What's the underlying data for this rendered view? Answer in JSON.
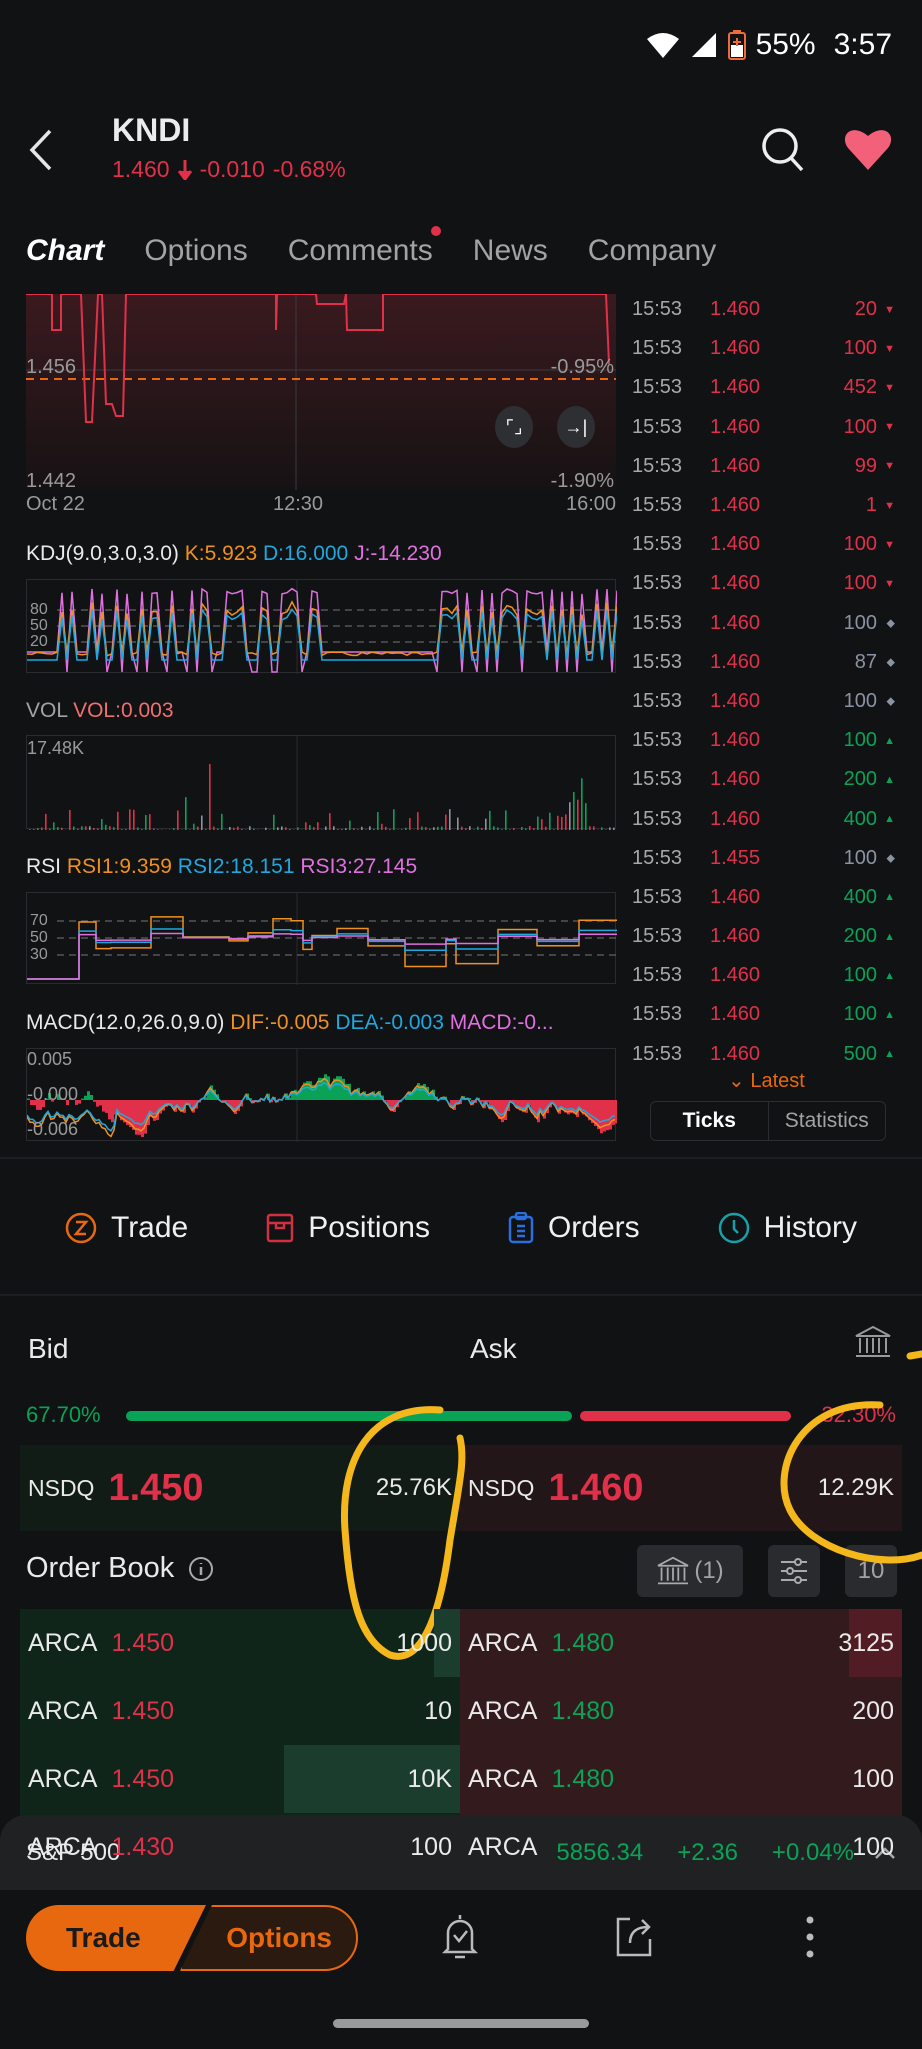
{
  "status_bar": {
    "battery": "55%",
    "time": "3:57"
  },
  "header": {
    "ticker": "KNDI",
    "price": "1.460",
    "change": "-0.010",
    "change_pct": "-0.68%",
    "direction": "down"
  },
  "tabs": [
    {
      "label": "Chart",
      "active": true
    },
    {
      "label": "Options",
      "active": false
    },
    {
      "label": "Comments",
      "active": false,
      "badge": true
    },
    {
      "label": "News",
      "active": false
    },
    {
      "label": "Company",
      "active": false
    }
  ],
  "colors": {
    "up": "#0aa257",
    "down": "#e0304a",
    "accent": "#e8680f",
    "neutral": "#8a93a3",
    "kdj_k": "#f0901e",
    "kdj_d": "#1fa8e0",
    "kdj_j": "#e070e0"
  },
  "price_chart": {
    "left_labels": [
      "1.456",
      "1.442"
    ],
    "right_labels": [
      "-0.95%",
      "-1.90%"
    ],
    "x_labels": [
      "Oct 22",
      "12:30",
      "16:00"
    ],
    "prev_close_line": "dashed-orange",
    "buttons": [
      "fullscreen",
      "jump-to-latest"
    ]
  },
  "indicators": {
    "kdj": {
      "name": "KDJ(9.0,3.0,3.0)",
      "k": "K:5.923",
      "d": "D:16.000",
      "j": "J:-14.230",
      "levels": [
        "80",
        "50",
        "20"
      ]
    },
    "vol": {
      "name": "VOL",
      "value": "VOL:0.003",
      "max_label": "17.48K"
    },
    "rsi": {
      "name": "RSI",
      "rsi1": "RSI1:9.359",
      "rsi2": "RSI2:18.151",
      "rsi3": "RSI3:27.145",
      "levels": [
        "70",
        "50",
        "30"
      ]
    },
    "macd": {
      "name": "MACD(12.0,26.0,9.0)",
      "dif": "DIF:-0.005",
      "dea": "DEA:-0.003",
      "macd": "MACD:-0...",
      "labels": [
        "0.005",
        "-0.000",
        "-0.006"
      ]
    }
  },
  "ticks": [
    {
      "time": "15:53",
      "price": "1.460",
      "volume": "20",
      "side": "down"
    },
    {
      "time": "15:53",
      "price": "1.460",
      "volume": "100",
      "side": "down"
    },
    {
      "time": "15:53",
      "price": "1.460",
      "volume": "452",
      "side": "down"
    },
    {
      "time": "15:53",
      "price": "1.460",
      "volume": "100",
      "side": "down"
    },
    {
      "time": "15:53",
      "price": "1.460",
      "volume": "99",
      "side": "down"
    },
    {
      "time": "15:53",
      "price": "1.460",
      "volume": "1",
      "side": "down"
    },
    {
      "time": "15:53",
      "price": "1.460",
      "volume": "100",
      "side": "down"
    },
    {
      "time": "15:53",
      "price": "1.460",
      "volume": "100",
      "side": "down"
    },
    {
      "time": "15:53",
      "price": "1.460",
      "volume": "100",
      "side": "neutral"
    },
    {
      "time": "15:53",
      "price": "1.460",
      "volume": "87",
      "side": "neutral"
    },
    {
      "time": "15:53",
      "price": "1.460",
      "volume": "100",
      "side": "neutral"
    },
    {
      "time": "15:53",
      "price": "1.460",
      "volume": "100",
      "side": "up"
    },
    {
      "time": "15:53",
      "price": "1.460",
      "volume": "200",
      "side": "up"
    },
    {
      "time": "15:53",
      "price": "1.460",
      "volume": "400",
      "side": "up"
    },
    {
      "time": "15:53",
      "price": "1.455",
      "volume": "100",
      "side": "neutral"
    },
    {
      "time": "15:53",
      "price": "1.460",
      "volume": "400",
      "side": "up"
    },
    {
      "time": "15:53",
      "price": "1.460",
      "volume": "200",
      "side": "up"
    },
    {
      "time": "15:53",
      "price": "1.460",
      "volume": "100",
      "side": "up"
    },
    {
      "time": "15:53",
      "price": "1.460",
      "volume": "100",
      "side": "up"
    },
    {
      "time": "15:53",
      "price": "1.460",
      "volume": "500",
      "side": "up"
    }
  ],
  "ticks_panel": {
    "latest_label": "Latest",
    "tabs": [
      "Ticks",
      "Statistics"
    ],
    "active_tab": "Ticks"
  },
  "trade_bar": [
    {
      "label": "Trade",
      "icon": "trade-icon"
    },
    {
      "label": "Positions",
      "icon": "positions-icon"
    },
    {
      "label": "Orders",
      "icon": "orders-icon"
    },
    {
      "label": "History",
      "icon": "history-icon"
    }
  ],
  "quote_book": {
    "bid_label": "Bid",
    "ask_label": "Ask",
    "bid_pct": "67.70%",
    "ask_pct": "32.30%",
    "bid_ratio": 0.677,
    "best_bid": {
      "exchange": "NSDQ",
      "price": "1.450",
      "size": "25.76K"
    },
    "best_ask": {
      "exchange": "NSDQ",
      "price": "1.460",
      "size": "12.29K"
    }
  },
  "order_book": {
    "title": "Order Book",
    "exchange_filter": "(1)",
    "depth_label": "10",
    "bids": [
      {
        "exchange": "ARCA",
        "price": "1.450",
        "size": "1000",
        "fill": 0.06
      },
      {
        "exchange": "ARCA",
        "price": "1.450",
        "size": "10",
        "fill": 0.0
      },
      {
        "exchange": "ARCA",
        "price": "1.450",
        "size": "10K",
        "fill": 0.4
      },
      {
        "exchange": "ARCA",
        "price": "1.430",
        "size": "100",
        "fill": 0.0
      }
    ],
    "asks": [
      {
        "exchange": "ARCA",
        "price": "1.480",
        "size": "3125",
        "fill": 0.12
      },
      {
        "exchange": "ARCA",
        "price": "1.480",
        "size": "200",
        "fill": 0.0
      },
      {
        "exchange": "ARCA",
        "price": "1.480",
        "size": "100",
        "fill": 0.0
      },
      {
        "exchange": "ARCA",
        "price": "",
        "size": "100",
        "fill": 0.0
      }
    ]
  },
  "index_bar": {
    "name": "S&P 500",
    "value": "5856.34",
    "change": "+2.36",
    "change_pct": "+0.04%"
  },
  "bottom_nav": {
    "trade_label": "Trade",
    "options_label": "Options"
  }
}
